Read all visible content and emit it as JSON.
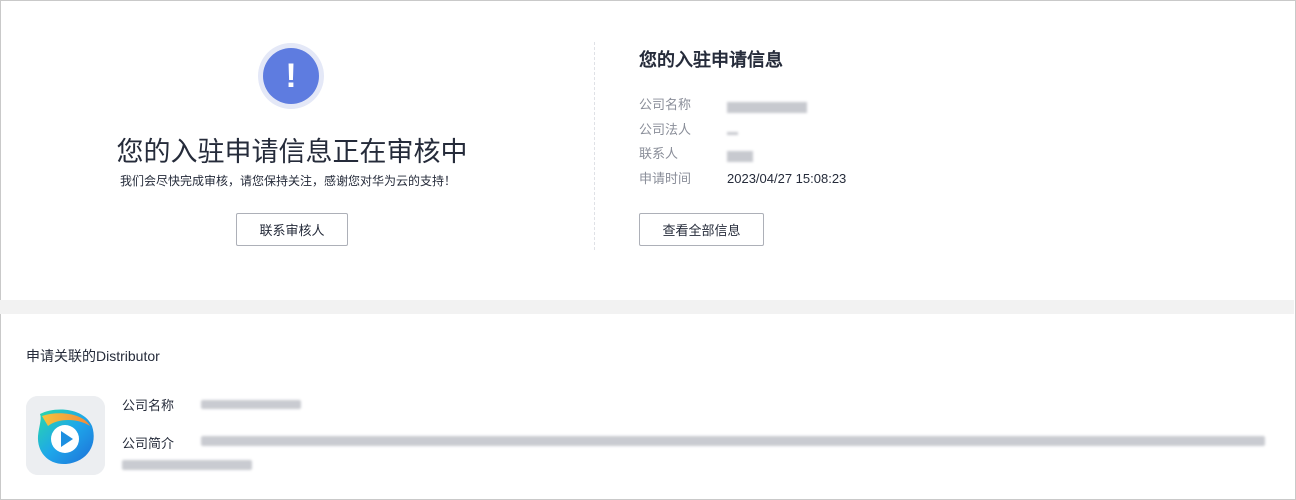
{
  "review": {
    "alert_symbol": "!",
    "title": "您的入驻申请信息正在审核中",
    "subtitle": "我们会尽快完成审核，请您保持关注，感谢您对华为云的支持！",
    "contact_button": "联系审核人"
  },
  "application_info": {
    "title": "您的入驻申请信息",
    "fields": [
      {
        "label": "公司名称",
        "value": ""
      },
      {
        "label": "公司法人",
        "value": ""
      },
      {
        "label": "联系人",
        "value": ""
      },
      {
        "label": "申请时间",
        "value": "2023/04/27 15:08:23"
      }
    ],
    "view_all_button": "查看全部信息"
  },
  "distributor": {
    "heading": "申请关联的Distributor",
    "logo_icon": "app-logo-icon",
    "name_label": "公司名称",
    "intro_label": "公司简介"
  },
  "colors": {
    "accent": "#5e7ce0",
    "accent_ring": "#e4e8f7",
    "text": "#252b3a",
    "muted": "#8a8e99",
    "border": "#adb0b8",
    "band": "#f2f2f2"
  }
}
